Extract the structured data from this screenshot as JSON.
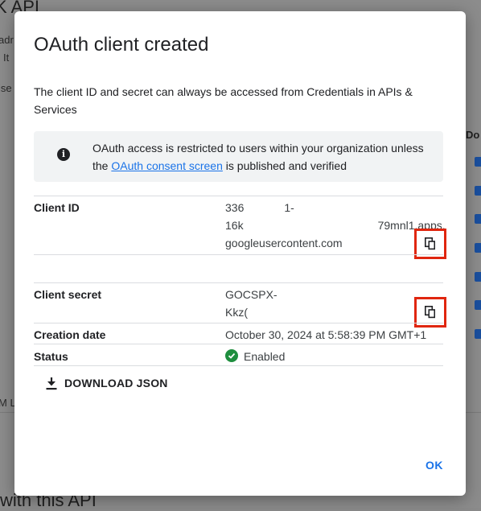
{
  "background": {
    "title_fragment": "K API",
    "side_fragments": [
      "adr",
      "It",
      "ise"
    ],
    "left_fragment": "M L",
    "bottom_fragment": "with this API",
    "right_header": "Do"
  },
  "dialog": {
    "title": "OAuth client created",
    "intro": "The client ID and secret can always be accessed from Credentials in APIs & Services",
    "notice": {
      "icon": "info-icon",
      "text_before": "OAuth access is restricted to users within your organization unless the ",
      "link": "OAuth consent screen",
      "text_after": " is published and verified"
    },
    "client_id": {
      "label": "Client ID",
      "line1_start": "336",
      "line1_end": "1-",
      "line2_start": "16k",
      "line2_end": "79mnl1.apps.",
      "line3": "googleusercontent.com",
      "copy_icon": "copy-icon"
    },
    "client_secret": {
      "label": "Client secret",
      "line1": "GOCSPX-",
      "line2": "Kkz(",
      "copy_icon": "copy-icon"
    },
    "creation_date": {
      "label": "Creation date",
      "value": "October 30, 2024 at 5:58:39 PM GMT+1"
    },
    "status": {
      "label": "Status",
      "value": "Enabled",
      "icon": "check-circle-icon",
      "color": "#1e8e3e"
    },
    "download_label": "DOWNLOAD JSON",
    "ok_label": "OK"
  },
  "colors": {
    "accent": "#1a73e8",
    "highlight": "#e0260f"
  }
}
